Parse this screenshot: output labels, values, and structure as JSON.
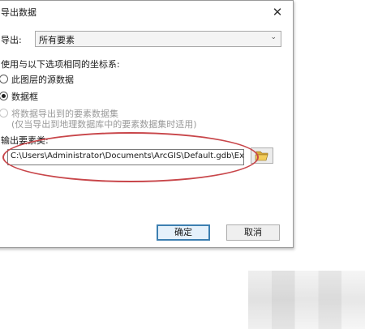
{
  "dialog": {
    "title": "导出数据",
    "close_symbol": "✕"
  },
  "export": {
    "label": "导出:",
    "selected": "所有要素",
    "chevron": "⌄"
  },
  "coordinate_section": {
    "label": "使用与以下选项相同的坐标系:",
    "options": [
      {
        "label": "此图层的源数据",
        "checked": false,
        "disabled": false
      },
      {
        "label": "数据框",
        "checked": true,
        "disabled": false
      },
      {
        "label": "将数据导出到的要素数据集",
        "checked": false,
        "disabled": true
      }
    ],
    "note": "(仅当导出到地理数据库中的要素数据集时适用)"
  },
  "output": {
    "label": "输出要素类:",
    "path": "C:\\Users\\Administrator\\Documents\\ArcGIS\\Default.gdb\\Export_C"
  },
  "buttons": {
    "ok": "确定",
    "cancel": "取消"
  },
  "colors": {
    "annotation_ellipse": "#c8464a",
    "primary_button_border": "#3c7fb1"
  }
}
